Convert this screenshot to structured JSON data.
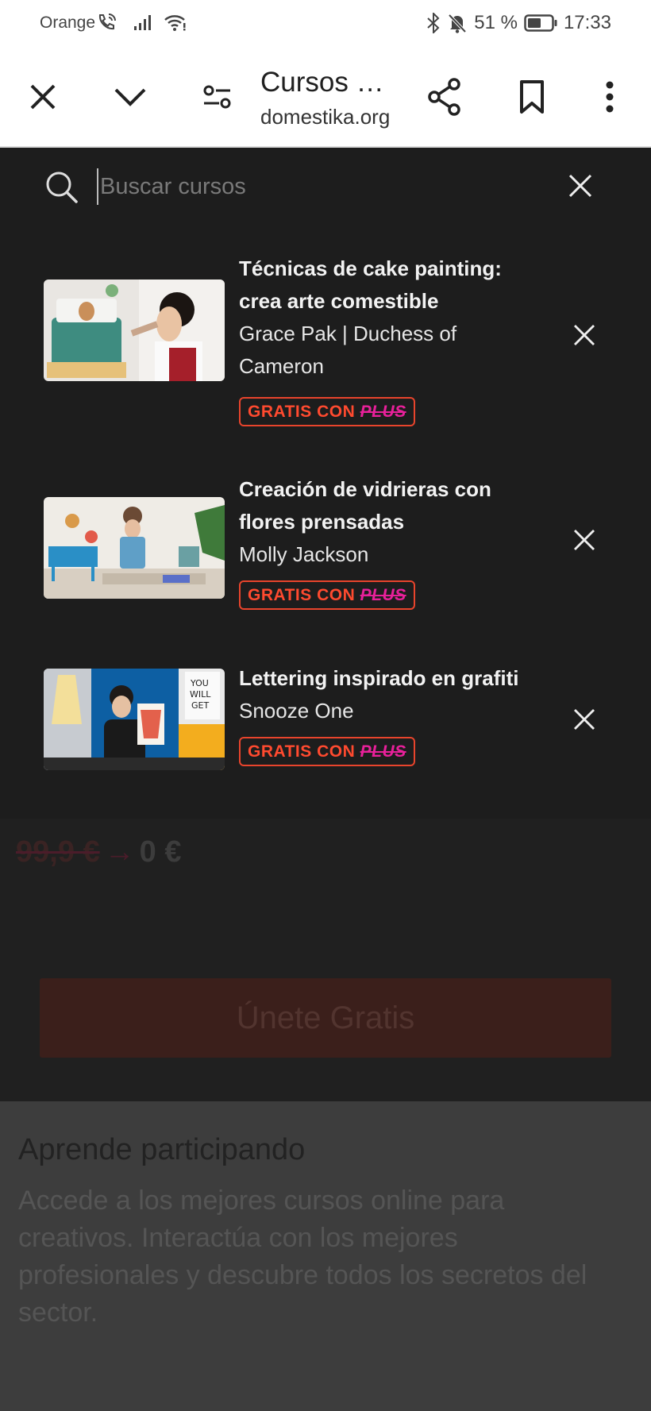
{
  "status_bar": {
    "carrier": "Orange",
    "battery": "51 %",
    "time": "17:33",
    "icons": [
      "wifi-call-icon",
      "signal-icon",
      "wifi-icon",
      "bluetooth-icon",
      "bell-muted-icon",
      "battery-icon"
    ]
  },
  "toolbar": {
    "title": "Cursos …",
    "url": "domestika.org",
    "icons": [
      "close-icon",
      "chevron-down-icon",
      "site-settings-icon",
      "share-icon",
      "bookmark-icon",
      "more-vert-icon"
    ]
  },
  "search": {
    "placeholder": "Buscar cursos",
    "value": ""
  },
  "results": [
    {
      "title": "Técnicas de cake painting: crea arte comestible",
      "author": "Grace Pak | Duchess of Cameron",
      "badge_text": "GRATIS CON",
      "badge_plus": "PLUS"
    },
    {
      "title": "Creación de vidrieras con flores prensadas",
      "author": "Molly Jackson",
      "badge_text": "GRATIS CON",
      "badge_plus": "PLUS"
    },
    {
      "title": "Lettering inspirado en grafiti",
      "author": "Snooze One",
      "badge_text": "GRATIS CON",
      "badge_plus": "PLUS"
    }
  ],
  "background_page": {
    "old_price": "99,9 €",
    "arrow": "→",
    "new_price": "0 €",
    "join_button": "Únete Gratis",
    "section_heading": "Aprende participando",
    "section_text": "Accede a los mejores cursos online para creativos. Interactúa con los mejores profesionales y descubre todos los secretos del sector."
  },
  "colors": {
    "badge_red": "#ff4a2f",
    "badge_plus": "#e8209a",
    "overlay_bg": "#1d1d1d"
  }
}
